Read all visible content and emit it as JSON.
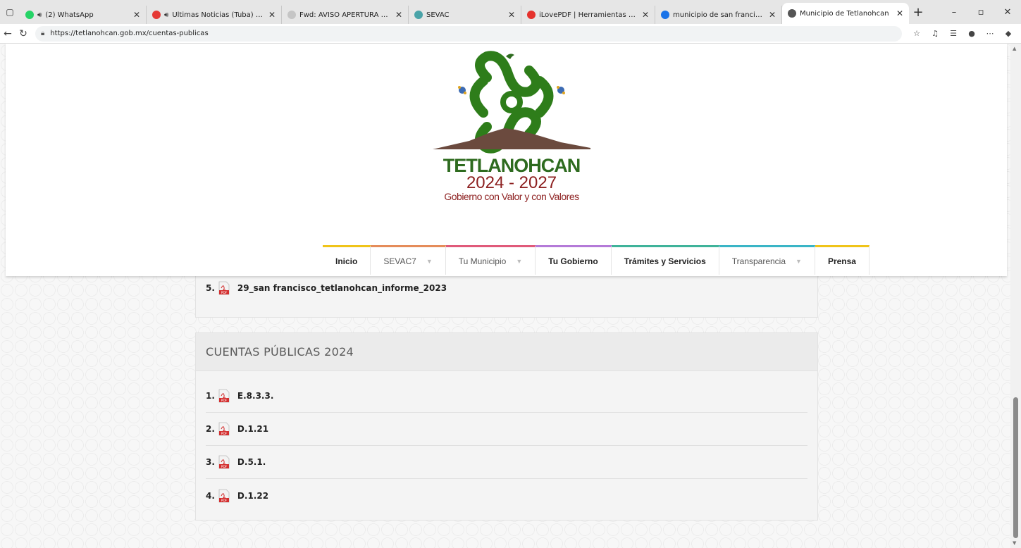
{
  "browser": {
    "tabs": [
      {
        "label": "(2) WhatsApp",
        "audio": true,
        "color": "#25d366"
      },
      {
        "label": "Ultimas Noticias (Tuba) - You",
        "audio": true,
        "color": "#e53935"
      },
      {
        "label": "Fwd: AVISO APERTURA DE PLATA",
        "audio": false,
        "color": "#c5c5c5"
      },
      {
        "label": "SEVAC",
        "audio": false,
        "color": "#4aa3a8"
      },
      {
        "label": "iLovePDF | Herramientas PDF onl",
        "audio": false,
        "color": "#e5322d"
      },
      {
        "label": "municipio de san francisco tetlan",
        "audio": false,
        "color": "#1a73e8"
      },
      {
        "label": "Municipio de Tetlanohcan",
        "audio": false,
        "color": "#555555",
        "active": true
      }
    ],
    "url": "https://tetlanohcan.gob.mx/cuentas-publicas"
  },
  "logo": {
    "name": "TETLANOHCAN",
    "years": "2024 - 2027",
    "slogan": "Gobierno con Valor y con Valores"
  },
  "menu": [
    {
      "label": "Inicio",
      "caret": false,
      "color": "#f0c419"
    },
    {
      "label": "SEVAC7",
      "caret": true,
      "color": "#e58c5a"
    },
    {
      "label": "Tu Municipio",
      "caret": true,
      "color": "#e05a7a"
    },
    {
      "label": "Tu Gobierno",
      "caret": false,
      "color": "#b47ad8"
    },
    {
      "label": "Trámites y Servicios",
      "caret": false,
      "color": "#3fb39a"
    },
    {
      "label": "Transparencia",
      "caret": true,
      "color": "#3ab5c6"
    },
    {
      "label": "Prensa",
      "caret": false,
      "color": "#f0c419"
    }
  ],
  "prev_section": {
    "items": [
      {
        "num": "5.",
        "name": "29_san francisco_tetlanohcan_informe_2023"
      }
    ]
  },
  "section_2024": {
    "title": "CUENTAS PÚBLICAS 2024",
    "items": [
      {
        "num": "1.",
        "name": "E.8.3.3."
      },
      {
        "num": "2.",
        "name": "D.1.21"
      },
      {
        "num": "3.",
        "name": "D.5.1."
      },
      {
        "num": "4.",
        "name": "D.1.22"
      }
    ]
  }
}
